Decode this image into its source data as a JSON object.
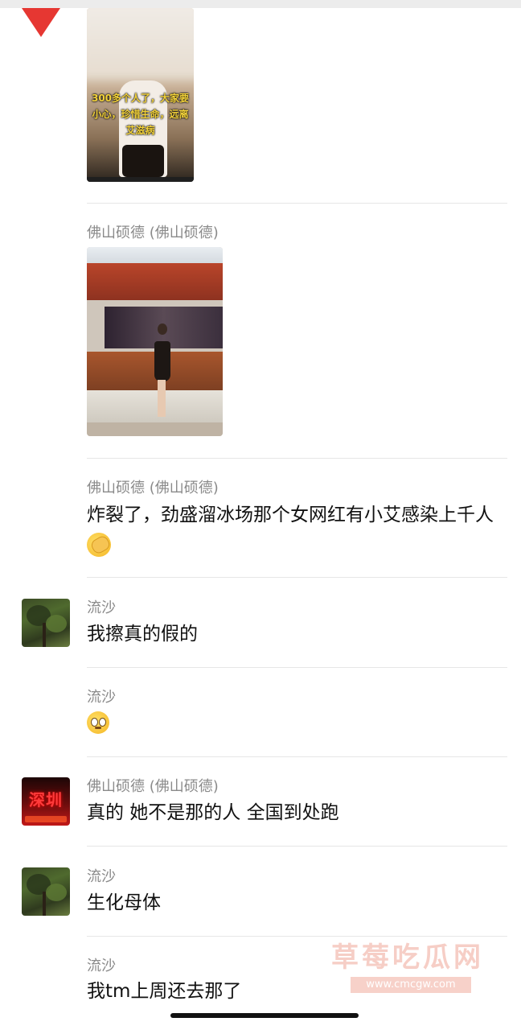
{
  "messages": [
    {
      "sender": "",
      "thumbnail_caption": "300多个人了，大家要小心，珍惜生命，远离艾滋病"
    },
    {
      "sender": "佛山硕德 (佛山硕德)"
    },
    {
      "sender": "佛山硕德 (佛山硕德)",
      "text": "炸裂了，劲盛溜冰场那个女网红有小艾感染上千人",
      "emoji": "facepalm-emoji"
    },
    {
      "sender": "流沙",
      "text": "我擦真的假的"
    },
    {
      "sender": "流沙",
      "emoji": "flushed-emoji"
    },
    {
      "sender": "佛山硕德 (佛山硕德)",
      "text": "真的 她不是那的人 全国到处跑",
      "avatar_text": "深圳"
    },
    {
      "sender": "流沙",
      "text": "生化母体"
    },
    {
      "sender": "流沙",
      "text": "我tm上周还去那了"
    }
  ],
  "watermark": {
    "title": "草莓吃瓜网",
    "url": "www.cmcgw.com"
  },
  "colors": {
    "name_gray": "#8a8a8a",
    "text": "#111111",
    "watermark": "#f5c2b8",
    "background": "#ffffff"
  }
}
